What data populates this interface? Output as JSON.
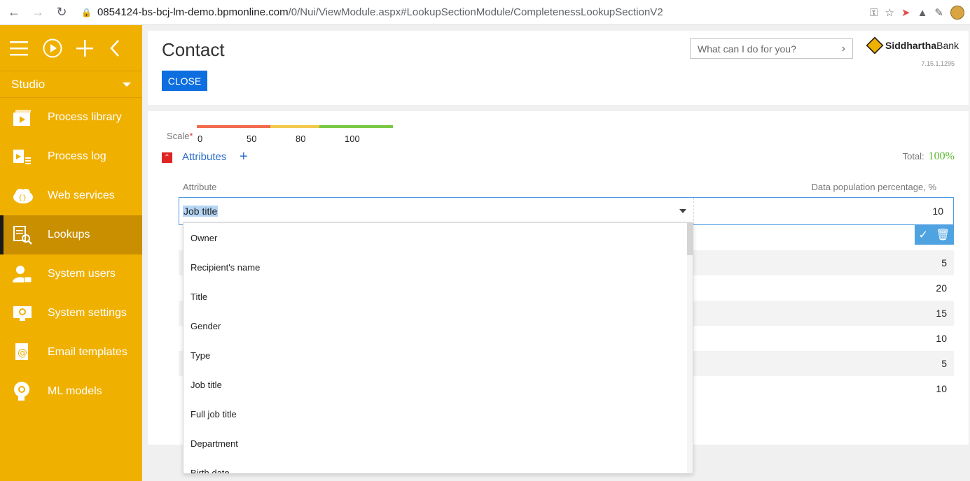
{
  "browser": {
    "url_host": "0854124-bs-bcj-lm-demo.bpmonline.com",
    "url_path": "/0/Nui/ViewModule.aspx#LookupSectionModule/CompletenessLookupSectionV2"
  },
  "sidebar": {
    "studio_label": "Studio",
    "items": [
      {
        "label": "Process library",
        "icon": "process-library-icon"
      },
      {
        "label": "Process log",
        "icon": "process-log-icon"
      },
      {
        "label": "Web services",
        "icon": "web-services-icon"
      },
      {
        "label": "Lookups",
        "icon": "lookups-icon",
        "active": true
      },
      {
        "label": "System users",
        "icon": "system-users-icon"
      },
      {
        "label": "System settings",
        "icon": "system-settings-icon"
      },
      {
        "label": "Email templates",
        "icon": "email-templates-icon"
      },
      {
        "label": "ML models",
        "icon": "ml-models-icon"
      }
    ]
  },
  "header": {
    "title": "Contact",
    "close_label": "CLOSE",
    "search_placeholder": "What can I do for you?",
    "logo_bold": "Siddhartha",
    "logo_light": "Bank",
    "version": "7.15.1.1295"
  },
  "scale": {
    "label": "Scale",
    "ticks": [
      "0",
      "50",
      "80",
      "100"
    ],
    "colors": [
      "#f26b4f",
      "#f2c94c",
      "#7ac943"
    ]
  },
  "attributes": {
    "label": "Attributes",
    "total_label": "Total:",
    "total_value": "100%",
    "col_attribute": "Attribute",
    "col_percentage": "Data population percentage, %",
    "edit_value": "Job title",
    "edit_percentage": "10",
    "row_values": [
      "",
      "5",
      "20",
      "15",
      "10",
      "5",
      "10"
    ]
  },
  "dropdown": {
    "options": [
      "Owner",
      "Recipient's name",
      "Title",
      "Gender",
      "Type",
      "Job title",
      "Full job title",
      "Department",
      "Birth date"
    ]
  }
}
